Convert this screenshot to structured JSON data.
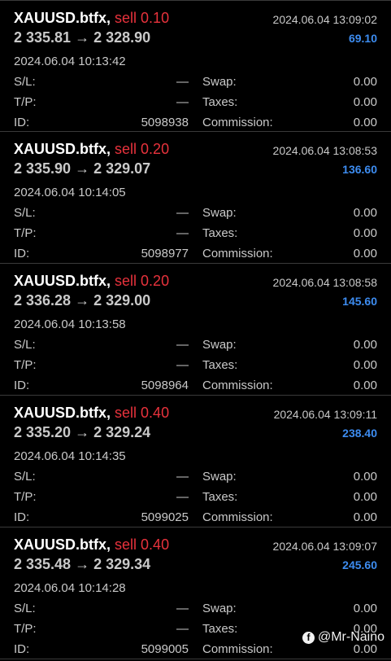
{
  "deals": [
    {
      "symbol": "XAUUSD.btfx,",
      "side": "sell 0.10",
      "open_time": "2024.06.04 13:09:02",
      "prices": "2 335.81 → 2 328.90",
      "profit": "69.10",
      "close_time": "2024.06.04 10:13:42",
      "sl_label": "S/L:",
      "sl": "—",
      "tp_label": "T/P:",
      "tp": "—",
      "id_label": "ID:",
      "id": "5098938",
      "swap_label": "Swap:",
      "swap": "0.00",
      "taxes_label": "Taxes:",
      "taxes": "0.00",
      "commission_label": "Commission:",
      "commission": "0.00"
    },
    {
      "symbol": "XAUUSD.btfx,",
      "side": "sell 0.20",
      "open_time": "2024.06.04 13:08:53",
      "prices": "2 335.90 → 2 329.07",
      "profit": "136.60",
      "close_time": "2024.06.04 10:14:05",
      "sl_label": "S/L:",
      "sl": "—",
      "tp_label": "T/P:",
      "tp": "—",
      "id_label": "ID:",
      "id": "5098977",
      "swap_label": "Swap:",
      "swap": "0.00",
      "taxes_label": "Taxes:",
      "taxes": "0.00",
      "commission_label": "Commission:",
      "commission": "0.00"
    },
    {
      "symbol": "XAUUSD.btfx,",
      "side": "sell 0.20",
      "open_time": "2024.06.04 13:08:58",
      "prices": "2 336.28 → 2 329.00",
      "profit": "145.60",
      "close_time": "2024.06.04 10:13:58",
      "sl_label": "S/L:",
      "sl": "—",
      "tp_label": "T/P:",
      "tp": "—",
      "id_label": "ID:",
      "id": "5098964",
      "swap_label": "Swap:",
      "swap": "0.00",
      "taxes_label": "Taxes:",
      "taxes": "0.00",
      "commission_label": "Commission:",
      "commission": "0.00"
    },
    {
      "symbol": "XAUUSD.btfx,",
      "side": "sell 0.40",
      "open_time": "2024.06.04 13:09:11",
      "prices": "2 335.20 → 2 329.24",
      "profit": "238.40",
      "close_time": "2024.06.04 10:14:35",
      "sl_label": "S/L:",
      "sl": "—",
      "tp_label": "T/P:",
      "tp": "—",
      "id_label": "ID:",
      "id": "5099025",
      "swap_label": "Swap:",
      "swap": "0.00",
      "taxes_label": "Taxes:",
      "taxes": "0.00",
      "commission_label": "Commission:",
      "commission": "0.00"
    },
    {
      "symbol": "XAUUSD.btfx,",
      "side": "sell 0.40",
      "open_time": "2024.06.04 13:09:07",
      "prices": "2 335.48 → 2 329.34",
      "profit": "245.60",
      "close_time": "2024.06.04 10:14:28",
      "sl_label": "S/L:",
      "sl": "—",
      "tp_label": "T/P:",
      "tp": "—",
      "id_label": "ID:",
      "id": "5099005",
      "swap_label": "Swap:",
      "swap": "0.00",
      "taxes_label": "Taxes:",
      "taxes": "0.00",
      "commission_label": "Commission:",
      "commission": "0.00"
    }
  ],
  "watermark": {
    "icon": "facebook-icon",
    "text": "@Mr-Naino"
  },
  "colors": {
    "background": "#000000",
    "sell": "#e8323c",
    "profit": "#3d8cf0",
    "divider": "#3a3a3a"
  }
}
